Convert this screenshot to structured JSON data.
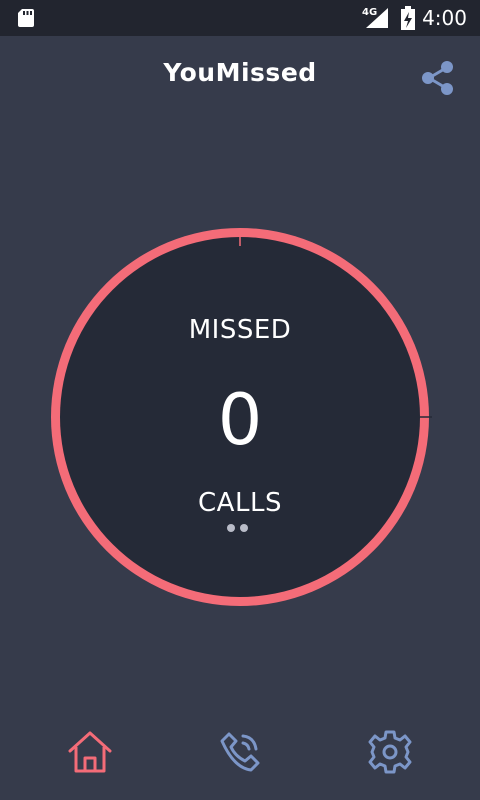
{
  "status_bar": {
    "network": "4G",
    "time": "4:00",
    "icons": [
      "sd-card-icon",
      "signal-icon",
      "battery-charging-icon"
    ]
  },
  "app_bar": {
    "title": "YouMissed",
    "share_icon": "share-icon"
  },
  "counter": {
    "label_top": "MISSED",
    "count": "0",
    "label_bottom": "CALLS",
    "pages": 2,
    "current_page": 0
  },
  "bottom_nav": {
    "items": [
      {
        "name": "home",
        "icon": "home-icon",
        "active": true
      },
      {
        "name": "calls",
        "icon": "phone-icon",
        "active": false
      },
      {
        "name": "settings",
        "icon": "gear-icon",
        "active": false
      }
    ]
  },
  "colors": {
    "background": "#363b4b",
    "status_bar": "#22252f",
    "dial_fill": "#252a37",
    "accent_red": "#f46c78",
    "icon_blue": "#7c96c8",
    "text": "#ffffff"
  }
}
